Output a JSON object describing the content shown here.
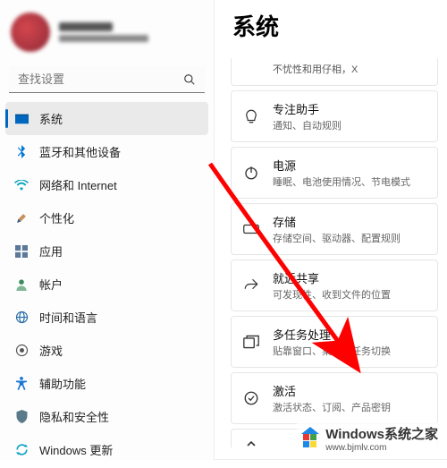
{
  "user": {
    "name_blurred": true
  },
  "search": {
    "placeholder": "查找设置"
  },
  "page": {
    "title": "系统"
  },
  "sidebar": {
    "items": [
      {
        "label": "系统",
        "icon": "system-icon",
        "active": true
      },
      {
        "label": "蓝牙和其他设备",
        "icon": "bluetooth-icon"
      },
      {
        "label": "网络和 Internet",
        "icon": "wifi-icon"
      },
      {
        "label": "个性化",
        "icon": "personalize-icon"
      },
      {
        "label": "应用",
        "icon": "apps-icon"
      },
      {
        "label": "帐户",
        "icon": "accounts-icon"
      },
      {
        "label": "时间和语言",
        "icon": "time-lang-icon"
      },
      {
        "label": "游戏",
        "icon": "gaming-icon"
      },
      {
        "label": "辅助功能",
        "icon": "accessibility-icon"
      },
      {
        "label": "隐私和安全性",
        "icon": "privacy-icon"
      },
      {
        "label": "Windows 更新",
        "icon": "update-icon"
      }
    ]
  },
  "cards": [
    {
      "title_partial": "不忧性和用仔相，X"
    },
    {
      "title": "专注助手",
      "subtitle": "通知、自动规则",
      "icon": "focus-icon"
    },
    {
      "title": "电源",
      "subtitle": "睡眠、电池使用情况、节电模式",
      "icon": "power-icon"
    },
    {
      "title": "存储",
      "subtitle": "存储空间、驱动器、配置规则",
      "icon": "storage-icon"
    },
    {
      "title": "就近共享",
      "subtitle": "可发现性、收到文件的位置",
      "icon": "share-icon"
    },
    {
      "title": "多任务处理",
      "subtitle": "贴靠窗口、桌面、任务切换",
      "icon": "multitask-icon"
    },
    {
      "title": "激活",
      "subtitle": "激活状态、订阅、产品密钥",
      "icon": "activation-icon"
    },
    {
      "title_partial_bottom": ""
    }
  ],
  "watermark": {
    "brand": "Windows",
    "suffix": "系统之家",
    "url": "www.bjmlv.com"
  }
}
